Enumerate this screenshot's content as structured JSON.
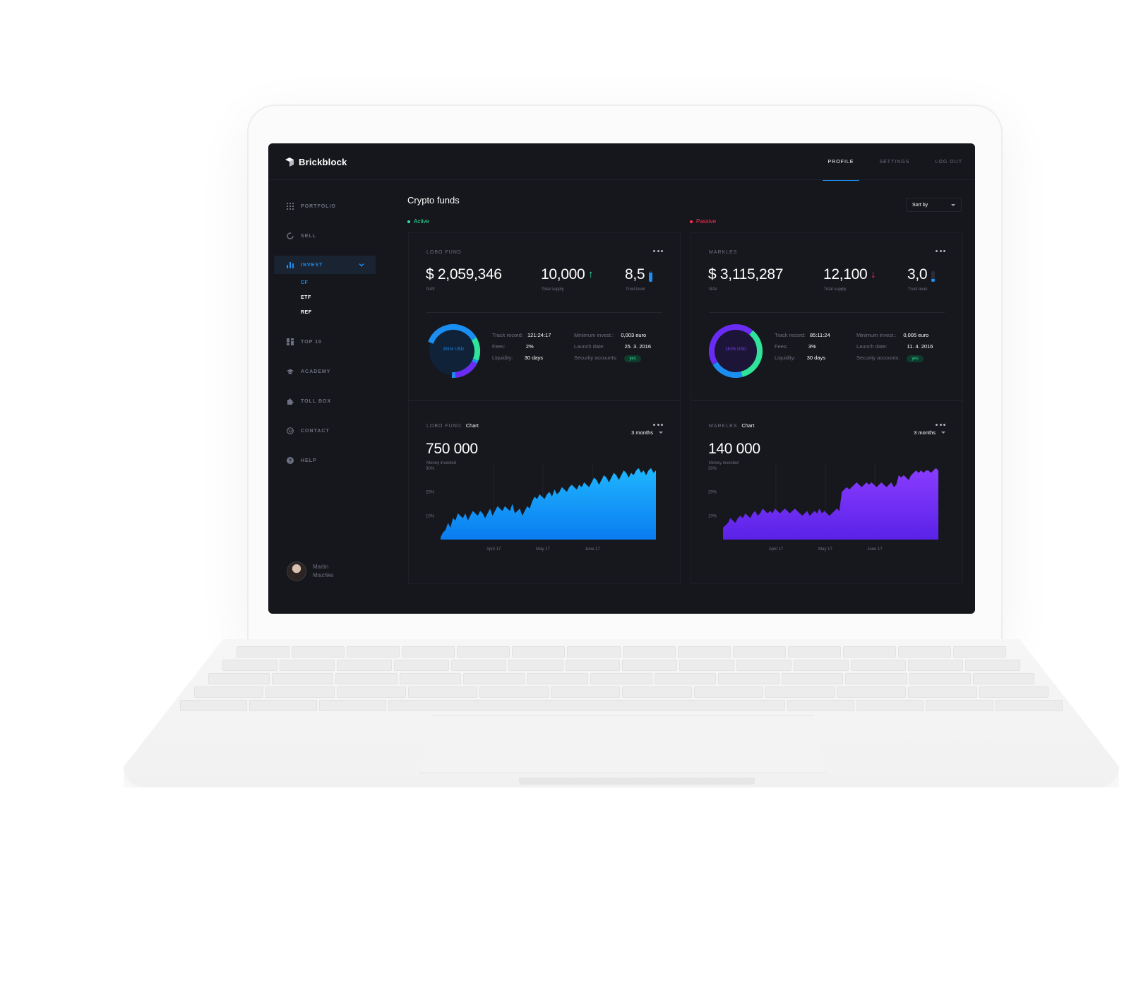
{
  "app": {
    "brand": "Brickblock",
    "topnav": [
      "PROFILE",
      "SETTINGS",
      "LOG OUT"
    ]
  },
  "sidebar": {
    "items": [
      {
        "label": "PORTFOLIO",
        "icon": "grid-icon"
      },
      {
        "label": "SELL",
        "icon": "circle-icon"
      },
      {
        "label": "INVEST",
        "icon": "bar-chart-icon",
        "active": true
      },
      {
        "label": "TOP 10",
        "icon": "dashboard-icon"
      },
      {
        "label": "ACADEMY",
        "icon": "graduation-cap-icon"
      },
      {
        "label": "TOLL BOX",
        "icon": "puzzle-icon"
      },
      {
        "label": "CONTACT",
        "icon": "globe-icon"
      },
      {
        "label": "HELP",
        "icon": "help-icon"
      }
    ],
    "subitems": [
      "CF",
      "ETF",
      "REF"
    ],
    "user": {
      "first": "Martin",
      "last": "Mischke"
    }
  },
  "main": {
    "title": "Crypto funds",
    "sort_label": "Sort by"
  },
  "colors": {
    "accent": "#1b8ef2",
    "active": "#2fe39a",
    "passive": "#ff2d55",
    "purple": "#6a2cf5"
  },
  "funds": [
    {
      "status": "Active",
      "name": "LOBO FUND",
      "nav": "$ 2,059,346",
      "nav_label": "NAV",
      "supply": "10,000",
      "supply_label": "Total supply",
      "supply_trend": "up",
      "trust": "8,5",
      "trust_label": "Trust level",
      "trust_fraction": 0.85,
      "donut_text": "281% USD",
      "track_record_label": "Track record:",
      "track_record": "121:24:17",
      "fees_label": "Fees:",
      "fees": "2%",
      "liquidity_label": "Liquidity:",
      "liquidity": "30 days",
      "min_invest_label": "Minimum invest.:",
      "min_invest": "0,003 euro",
      "launch_label": "Launch date:",
      "launch": "25. 3. 2016",
      "security_label": "Security accounts:",
      "security": "yes",
      "chart_label": "Chart",
      "money": "750 000",
      "money_label": "Money invested",
      "range": "3 months"
    },
    {
      "status": "Passive",
      "name": "MARKLES",
      "nav": "$ 3,115,287",
      "nav_label": "NAV",
      "supply": "12,100",
      "supply_label": "Total supply",
      "supply_trend": "down",
      "trust": "3,0",
      "trust_label": "Trust level",
      "trust_fraction": 0.3,
      "donut_text": "181% USD",
      "track_record_label": "Track record:",
      "track_record": "85:11:24",
      "fees_label": "Fees:",
      "fees": "3%",
      "liquidity_label": "Liquidity:",
      "liquidity": "30 days",
      "min_invest_label": "Minimum invest.:",
      "min_invest": "0,005 euro",
      "launch_label": "Launch date:",
      "launch": "11. 4. 2016",
      "security_label": "Security accounts:",
      "security": "yes",
      "chart_label": "Chart",
      "money": "140 000",
      "money_label": "Money invested",
      "range": "3 months"
    }
  ],
  "chart_data": [
    {
      "type": "area",
      "y_ticks": [
        "30%",
        "20%",
        "10%"
      ],
      "x_ticks": [
        "April 17",
        "May 17",
        "June 17"
      ],
      "ylim": [
        0,
        32
      ],
      "values": [
        1,
        3,
        4,
        7,
        5,
        9,
        8,
        11,
        10,
        9,
        11,
        8,
        10,
        12,
        11,
        10,
        12,
        11,
        9,
        11,
        13,
        10,
        12,
        14,
        13,
        12,
        14,
        13,
        12,
        15,
        11,
        12,
        13,
        10,
        12,
        14,
        13,
        16,
        18,
        17,
        19,
        18,
        17,
        19,
        20,
        18,
        21,
        19,
        20,
        22,
        21,
        20,
        22,
        23,
        22,
        21,
        23,
        22,
        24,
        23,
        22,
        24,
        26,
        25,
        23,
        25,
        27,
        26,
        24,
        26,
        28,
        27,
        25,
        27,
        29,
        28,
        26,
        28,
        27,
        29,
        30,
        28,
        29,
        27,
        29,
        30,
        28,
        29
      ]
    },
    {
      "type": "area",
      "y_ticks": [
        "30%",
        "20%",
        "10%"
      ],
      "x_ticks": [
        "April 17",
        "May 17",
        "June 17"
      ],
      "ylim": [
        0,
        32
      ],
      "values": [
        5,
        6,
        7,
        9,
        8,
        7,
        9,
        10,
        9,
        11,
        10,
        9,
        11,
        12,
        10,
        11,
        13,
        12,
        11,
        12,
        11,
        13,
        12,
        11,
        12,
        13,
        12,
        11,
        12,
        13,
        12,
        11,
        10,
        11,
        12,
        10,
        11,
        12,
        11,
        13,
        11,
        12,
        11,
        10,
        11,
        12,
        13,
        12,
        20,
        21,
        22,
        21,
        22,
        23,
        24,
        23,
        22,
        23,
        24,
        23,
        24,
        23,
        22,
        23,
        24,
        23,
        22,
        23,
        24,
        22,
        23,
        27,
        26,
        27,
        26,
        25,
        27,
        28,
        29,
        28,
        29,
        28,
        29,
        29,
        28,
        29,
        30,
        29
      ]
    }
  ]
}
